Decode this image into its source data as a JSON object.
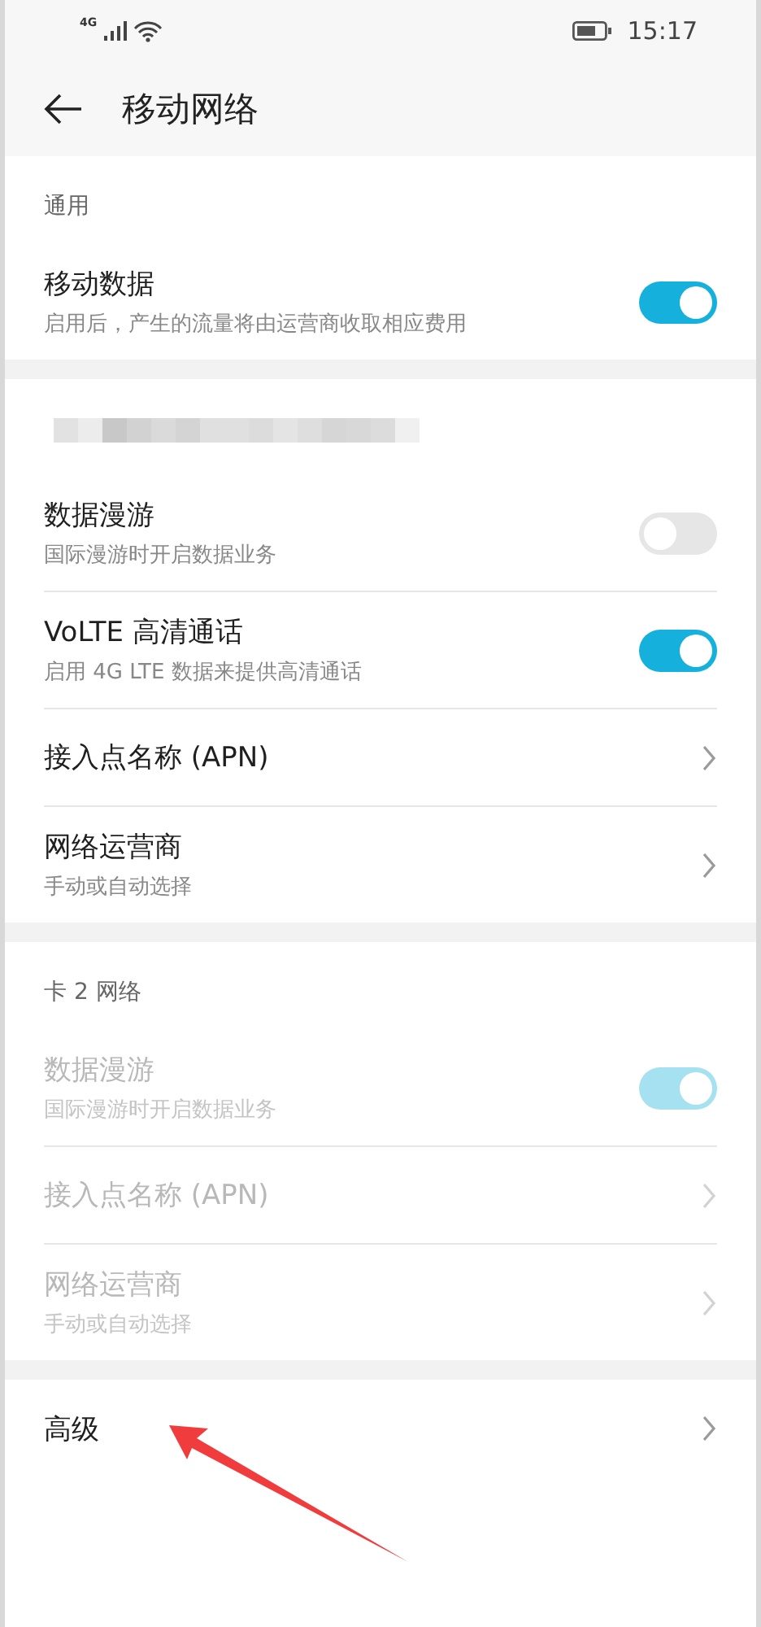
{
  "status_bar": {
    "network": "4G",
    "time": "15:17"
  },
  "header": {
    "title": "移动网络"
  },
  "sections": [
    {
      "title": "通用",
      "kind": "text",
      "rows": [
        {
          "kind": "toggle",
          "label": "移动数据",
          "subtitle": "启用后，产生的流量将由运营商收取相应费用",
          "on": true,
          "disabled": false
        }
      ]
    },
    {
      "kind": "redacted",
      "rows": [
        {
          "kind": "toggle",
          "label": "数据漫游",
          "subtitle": "国际漫游时开启数据业务",
          "on": false,
          "disabled": false
        },
        {
          "kind": "toggle",
          "label": "VoLTE 高清通话",
          "subtitle": "启用 4G LTE 数据来提供高清通话",
          "on": true,
          "disabled": false
        },
        {
          "kind": "link",
          "label": "接入点名称 (APN)",
          "disabled": false
        },
        {
          "kind": "link",
          "label": "网络运营商",
          "subtitle": "手动或自动选择",
          "disabled": false
        }
      ]
    },
    {
      "title": "卡 2 网络",
      "kind": "text",
      "rows": [
        {
          "kind": "toggle",
          "label": "数据漫游",
          "subtitle": "国际漫游时开启数据业务",
          "on": true,
          "disabled": true
        },
        {
          "kind": "link",
          "label": "接入点名称 (APN)",
          "disabled": true
        },
        {
          "kind": "link",
          "label": "网络运营商",
          "subtitle": "手动或自动选择",
          "disabled": true
        }
      ]
    },
    {
      "kind": "plain",
      "rows": [
        {
          "kind": "link",
          "label": "高级",
          "disabled": false
        }
      ]
    }
  ],
  "annotation": {
    "kind": "arrow",
    "color": "#f03c3c"
  }
}
